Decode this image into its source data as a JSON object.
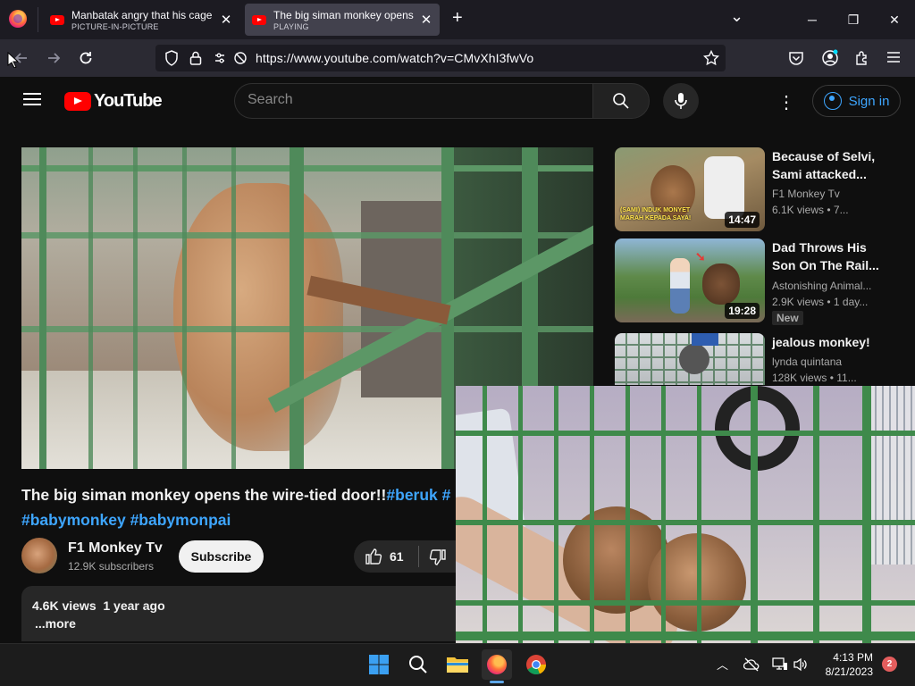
{
  "browser": {
    "tabs": [
      {
        "title": "Manbatak angry that his cage is",
        "subtitle": "PICTURE-IN-PICTURE"
      },
      {
        "title": "The big siman monkey opens the",
        "subtitle": "PLAYING"
      }
    ],
    "new_tab": "+",
    "list_tabs": "⌄",
    "window": {
      "minimize": "─",
      "maximize": "❐",
      "close": "✕"
    },
    "url": "https://www.youtube.com/watch?v=CMvXhI3fwVo"
  },
  "yt": {
    "logo_text": "YouTube",
    "search_placeholder": "Search",
    "sign_in": "Sign in"
  },
  "video": {
    "title_main": "The big siman monkey opens the wire-tied door!!",
    "title_hash1": "#beruk",
    "title_hash2": " #",
    "title_line2": "#babymonkey #babymonpai",
    "channel": "F1 Monkey Tv",
    "subscribers": "12.9K subscribers",
    "subscribe": "Subscribe",
    "likes": "61",
    "views_ago": "4.6K views  1 year ago",
    "more": "...more"
  },
  "recommendations": [
    {
      "title": "Because of Selvi, Sami attacked...",
      "channel": "F1 Monkey Tv",
      "meta": "6.1K views • 7...",
      "duration": "14:47",
      "overlay_text": "(SAMI) INDUK MONYET MARAH KEPADA SAYA!"
    },
    {
      "title": "Dad Throws His Son On The Rail...",
      "channel": "Astonishing Animal...",
      "meta": "2.9K views • 1 day...",
      "duration": "19:28",
      "badge": "New"
    },
    {
      "title": "jealous monkey!",
      "channel": "lynda quintana",
      "meta": "128K views • 11..."
    }
  ],
  "taskbar": {
    "time": "4:13 PM",
    "date": "8/21/2023",
    "notifications": "2"
  }
}
